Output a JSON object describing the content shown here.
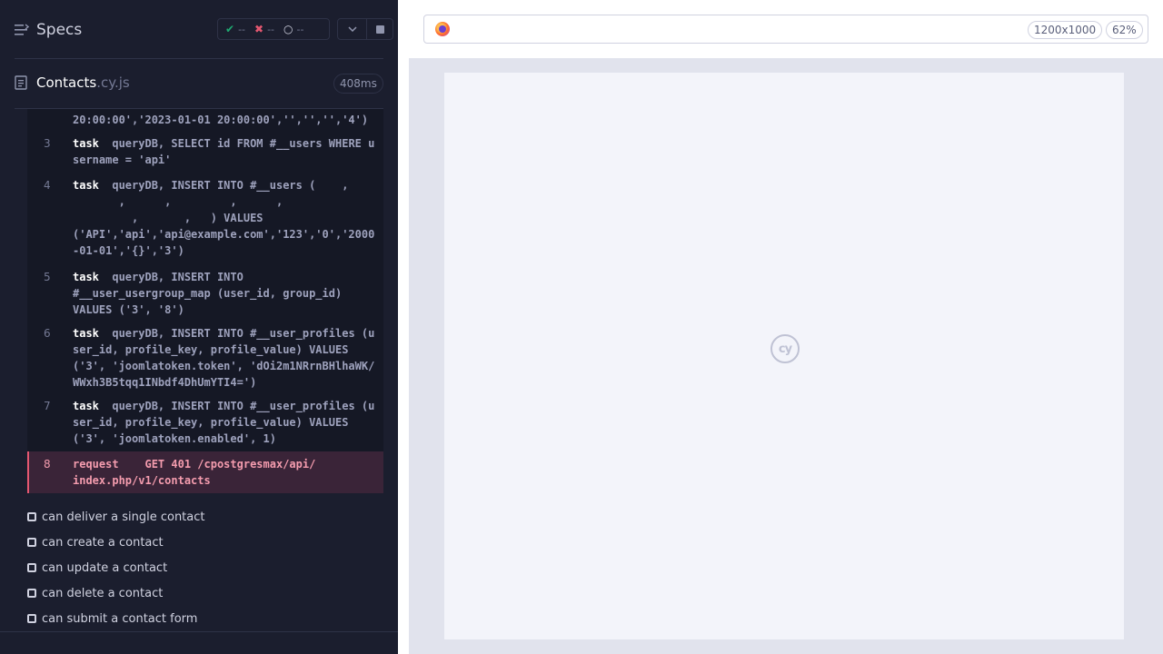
{
  "header": {
    "specs_label": "Specs",
    "stats": {
      "passed": "--",
      "failed": "--",
      "pending": "--"
    }
  },
  "spec": {
    "name": "Contacts",
    "ext": ".cy.js",
    "duration": "408ms"
  },
  "commands": [
    {
      "num": "",
      "name": "",
      "message": "20:00:00','2023-01-01 20:00:00','','','','4')"
    },
    {
      "num": "3",
      "name": "task",
      "message": "queryDB, SELECT id FROM #__users WHERE username = 'api'"
    },
    {
      "num": "4",
      "name": "task",
      "message": "queryDB, INSERT INTO #__users (    ,\n       ,      ,         ,      ,\n         ,       ,   ) VALUES\n('API','api','api@example.com','123','0','2000-01-01','{}','3')"
    },
    {
      "num": "5",
      "name": "task",
      "message": "queryDB, INSERT INTO\n#__user_usergroup_map (user_id, group_id)\nVALUES ('3', '8')"
    },
    {
      "num": "6",
      "name": "task",
      "message": "queryDB, INSERT INTO #__user_profiles (user_id, profile_key, profile_value) VALUES ('3', 'joomlatoken.token', 'dOi2m1NRrnBHlhaWK/WWxh3B5tqq1INbdf4DhUmYTI4=')"
    },
    {
      "num": "7",
      "name": "task",
      "message": "queryDB, INSERT INTO #__user_profiles (user_id, profile_key, profile_value) VALUES ('3', 'joomlatoken.enabled', 1)"
    },
    {
      "num": "8",
      "name": "request",
      "message": "GET 401 /cpostgresmax/api/\nindex.php/v1/contacts"
    }
  ],
  "tests": [
    "can deliver a single contact",
    "can create a contact",
    "can update a contact",
    "can delete a contact",
    "can submit a contact form"
  ],
  "viewport": {
    "size": "1200x1000",
    "zoom": "62%"
  },
  "aut": {
    "logo_text": "cy"
  },
  "colors": {
    "panel_bg": "#1b1e2e",
    "fail": "#e45770",
    "pass": "#1fa971"
  }
}
